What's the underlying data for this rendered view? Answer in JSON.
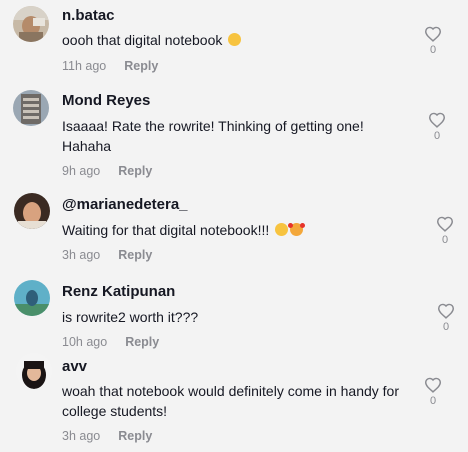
{
  "colors": {
    "background": "#f3f3f3",
    "username": "#161823",
    "meta": "#8a8b91"
  },
  "comments": [
    {
      "username": "n.batac",
      "text": "oooh that digital notebook",
      "emojis": [
        "grimace-emoji"
      ],
      "time": "11h ago",
      "reply": "Reply",
      "likes": "0"
    },
    {
      "username": "Mond Reyes",
      "text": "Isaaaa! Rate the rowrite! Thinking of getting one! Hahaha",
      "emojis": [],
      "time": "9h ago",
      "reply": "Reply",
      "likes": "0"
    },
    {
      "username": "@marianedetera_",
      "text": "Waiting for that digital notebook!!!",
      "emojis": [
        "grimace-emoji",
        "smiling-face-with-hearts-emoji"
      ],
      "time": "3h ago",
      "reply": "Reply",
      "likes": "0"
    },
    {
      "username": "Renz Katipunan",
      "text": "is rowrite2 worth it???",
      "emojis": [],
      "time": "10h ago",
      "reply": "Reply",
      "likes": "0"
    },
    {
      "username": "avv",
      "text": "woah that notebook would definitely come in handy for college students!",
      "emojis": [],
      "time": "3h ago",
      "reply": "Reply",
      "likes": "0"
    }
  ]
}
